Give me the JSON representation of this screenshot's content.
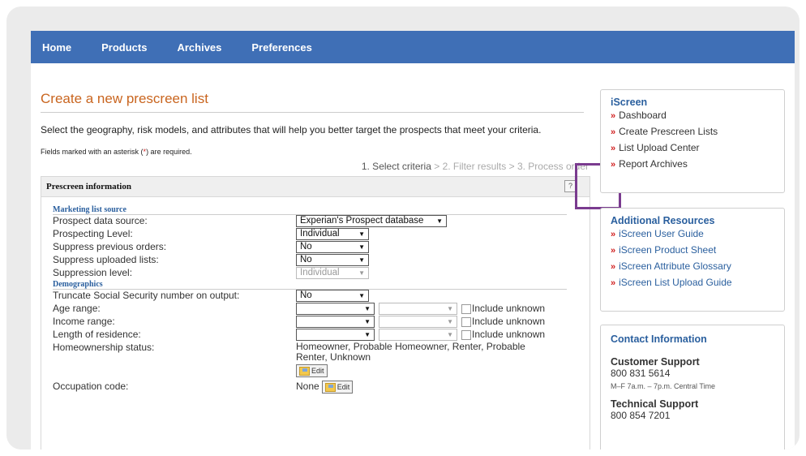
{
  "nav": {
    "items": [
      "Home",
      "Products",
      "Archives",
      "Preferences"
    ]
  },
  "main": {
    "title": "Create a new prescreen list",
    "intro": "Select the geography, risk models, and attributes that will help you better target the prospects that meet your criteria.",
    "required_prefix": "Fields marked with an asterisk (",
    "required_asterisk": "*",
    "required_suffix": ") are required.",
    "steps": {
      "step1": "1. Select criteria",
      "sep": " > ",
      "step2": "2. Filter results",
      "step3": "3. Process order"
    }
  },
  "panel": {
    "title": "Prescreen information",
    "help": "?",
    "marketing_section": "Marketing list source",
    "rows": {
      "data_source": {
        "label": "Prospect data source:",
        "value": "Experian's Prospect database"
      },
      "prospecting_level": {
        "label": "Prospecting Level:",
        "value": "Individual"
      },
      "suppress_prev": {
        "label": "Suppress previous orders:",
        "value": "No"
      },
      "suppress_uploaded": {
        "label": "Suppress uploaded lists:",
        "value": "No"
      },
      "suppression_level": {
        "label": "Suppression level:",
        "value": "Individual"
      }
    },
    "demographics_section": "Demographics",
    "demo": {
      "truncate": {
        "label": "Truncate Social Security number on output:",
        "value": "No"
      },
      "age": {
        "label": "Age range:",
        "include": "Include unknown"
      },
      "income": {
        "label": "Income range:",
        "include": "Include unknown"
      },
      "residence": {
        "label": "Length of residence:",
        "include": "Include unknown"
      },
      "homeownership": {
        "label": "Homeownership status:",
        "value": "Homeowner, Probable Homeowner, Renter, Probable Renter, Unknown",
        "edit": "Edit"
      },
      "occupation": {
        "label": "Occupation code:",
        "value": "None",
        "edit": "Edit"
      }
    }
  },
  "sidebar": {
    "iscreen": {
      "title": "iScreen",
      "links": [
        "Dashboard",
        "Create Prescreen Lists",
        "List Upload Center",
        "Report Archives"
      ]
    },
    "resources": {
      "title": "Additional Resources",
      "links": [
        "iScreen User Guide",
        "iScreen Product Sheet",
        "iScreen Attribute Glossary",
        "iScreen List Upload Guide"
      ]
    },
    "contact": {
      "title": "Contact Information",
      "customer_label": "Customer Support",
      "customer_phone": "800 831 5614",
      "customer_hours": "M–F 7a.m. – 7p.m. Central Time",
      "technical_label": "Technical Support",
      "technical_phone": "800 854 7201"
    }
  },
  "colors": {
    "nav": "#3f6fb6",
    "title": "#c9651f",
    "link": "#2a5f9e",
    "chevron": "#d01e1e",
    "highlight": "#7a3b8f"
  }
}
